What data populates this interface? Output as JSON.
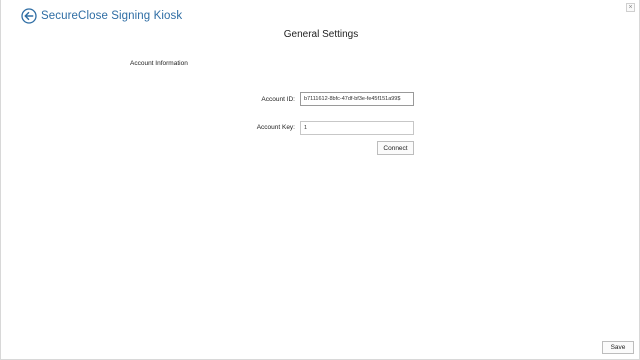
{
  "window": {
    "close_glyph": "×"
  },
  "header": {
    "app_title": "SecureClose Signing Kiosk",
    "back_icon": "back-arrow-circle-icon",
    "accent_color": "#2e6da4"
  },
  "page": {
    "title": "General Settings"
  },
  "account": {
    "section_title": "Account Information",
    "id_label": "Account ID:",
    "id_value": "b7111612-8bfc-47df-bf3e-fe45f151a99$",
    "key_label": "Account Key:",
    "key_value": "1",
    "connect_label": "Connect"
  },
  "footer": {
    "save_label": "Save"
  }
}
